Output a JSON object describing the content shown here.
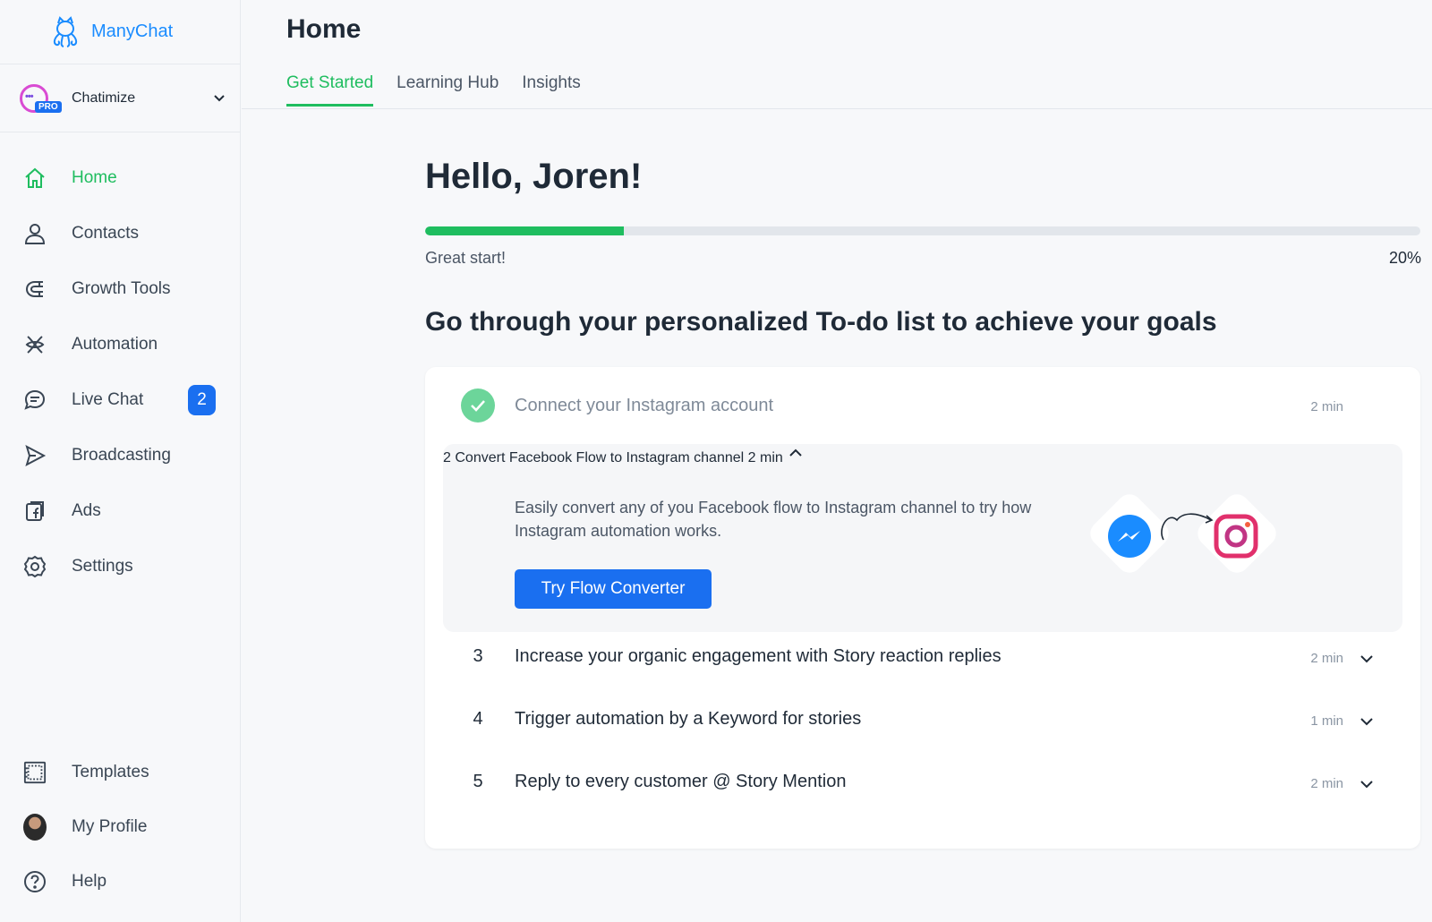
{
  "app": {
    "name": "ManyChat"
  },
  "account": {
    "name": "Chatimize",
    "plan_badge": "PRO"
  },
  "sidebar": {
    "items": [
      {
        "label": "Home",
        "icon": "home-icon",
        "active": true
      },
      {
        "label": "Contacts",
        "icon": "user-icon"
      },
      {
        "label": "Growth Tools",
        "icon": "magnet-icon"
      },
      {
        "label": "Automation",
        "icon": "automation-icon"
      },
      {
        "label": "Live Chat",
        "icon": "chat-icon",
        "badge": "2"
      },
      {
        "label": "Broadcasting",
        "icon": "send-icon"
      },
      {
        "label": "Ads",
        "icon": "facebook-ads-icon"
      },
      {
        "label": "Settings",
        "icon": "gear-icon"
      }
    ],
    "bottom_items": [
      {
        "label": "Templates",
        "icon": "templates-icon"
      },
      {
        "label": "My Profile",
        "icon": "avatar"
      },
      {
        "label": "Help",
        "icon": "help-icon"
      }
    ]
  },
  "header": {
    "title": "Home",
    "tabs": [
      {
        "label": "Get Started",
        "active": true
      },
      {
        "label": "Learning Hub"
      },
      {
        "label": "Insights"
      }
    ]
  },
  "main": {
    "greeting": "Hello, Joren!",
    "progress": {
      "label": "Great start!",
      "percent_text": "20%",
      "value": 0.2
    },
    "goal_heading": "Go through your personalized To-do list to achieve your goals",
    "todos": [
      {
        "title": "Connect your Instagram account",
        "time": "2 min",
        "done": true
      },
      {
        "number": "2",
        "title": "Convert Facebook Flow to Instagram channel",
        "time": "2 min",
        "expanded": true,
        "description": "Easily convert any of you Facebook flow to Instagram channel to try how Instagram automation works.",
        "button": "Try Flow Converter"
      },
      {
        "number": "3",
        "title": "Increase your organic engagement with Story reaction replies",
        "time": "2 min"
      },
      {
        "number": "4",
        "title": "Trigger automation by a Keyword for stories",
        "time": "1 min"
      },
      {
        "number": "5",
        "title": "Reply to every customer @ Story Mention",
        "time": "2 min"
      }
    ]
  },
  "colors": {
    "accent_green": "#1fbd5f",
    "brand_blue": "#1a6ff0",
    "check_green": "#6cd59a"
  }
}
